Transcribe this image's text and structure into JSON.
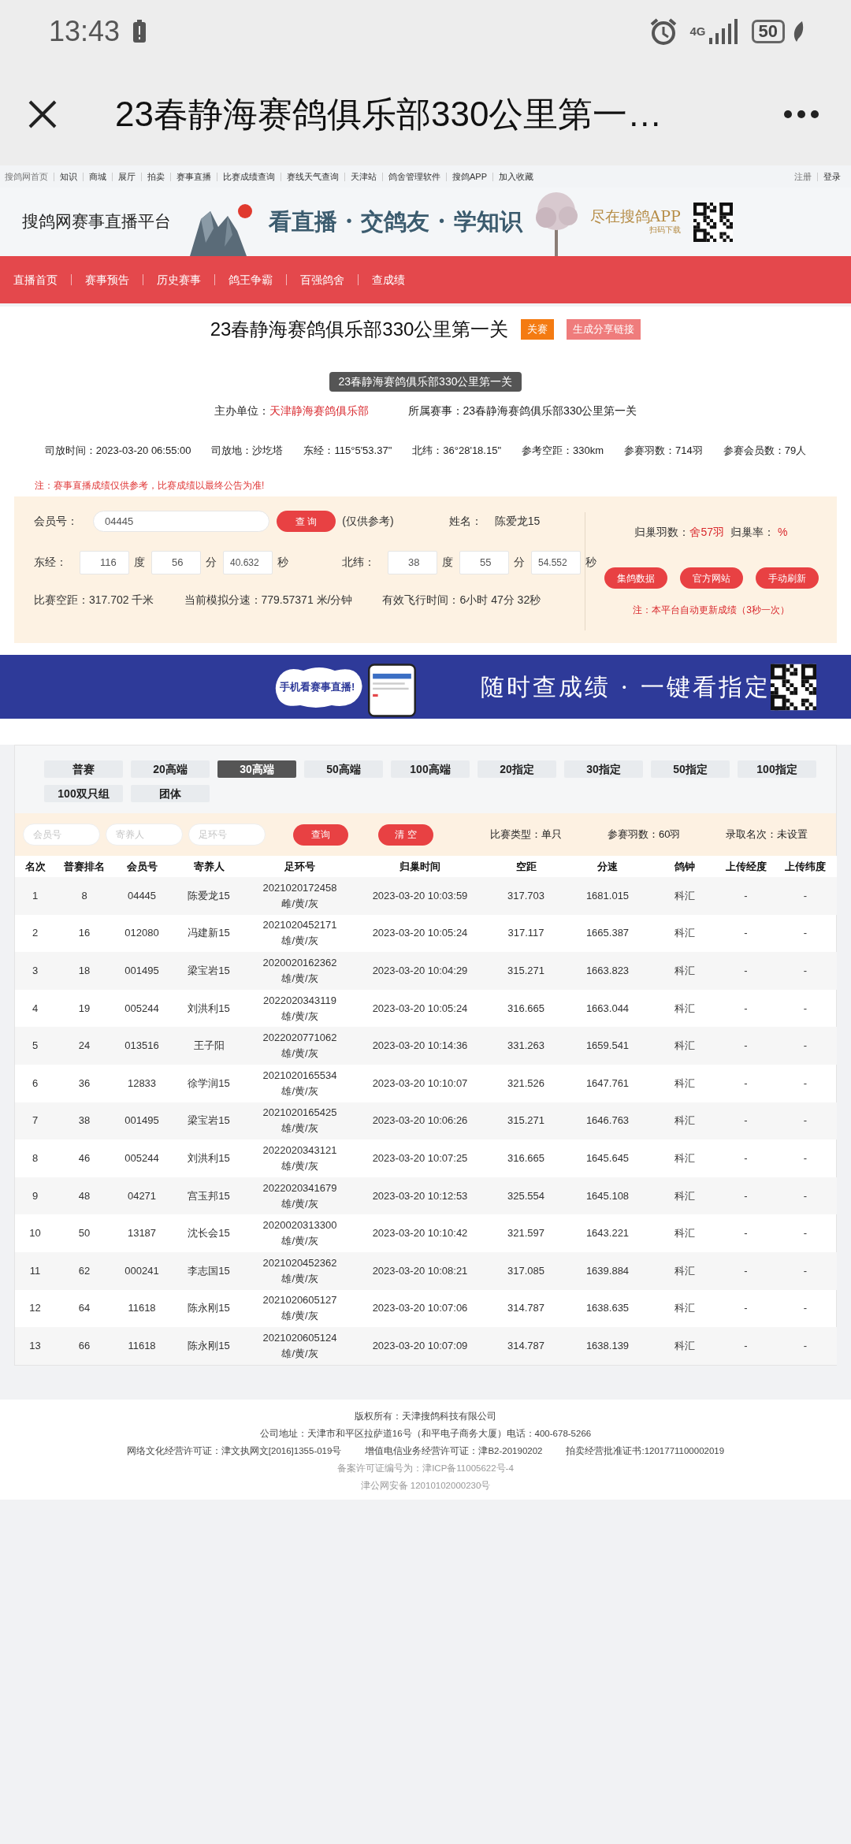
{
  "status_bar": {
    "time": "13:43",
    "network": "4G",
    "battery": "50"
  },
  "title_bar": {
    "title": "23春静海赛鸽俱乐部330公里第一…"
  },
  "top_links": {
    "left": [
      "搜鸽网首页",
      "知识",
      "商城",
      "展厅",
      "拍卖",
      "赛事直播",
      "比赛成绩查询",
      "赛线天气查询",
      "天津站",
      "鸽舍管理软件",
      "搜鸽APP",
      "加入收藏"
    ],
    "right": [
      "注册",
      "登录"
    ]
  },
  "banner": {
    "platform": "搜鸽网赛事直播平台",
    "slogan": "看直播 · 交鸽友 · 学知识",
    "app": "尽在搜鸽APP",
    "scan": "扫码下载"
  },
  "nav": [
    "直播首页",
    "赛事预告",
    "历史赛事",
    "鸽王争霸",
    "百强鸽舍",
    "查成绩"
  ],
  "race": {
    "title": "23春静海赛鸽俱乐部330公里第一关",
    "tag": "关赛",
    "share": "生成分享链接",
    "pill": "23春静海赛鸽俱乐部330公里第一关",
    "organizer_label": "主办单位：",
    "organizer": "天津静海赛鸽俱乐部",
    "event_label": "所属赛事：",
    "event": "23春静海赛鸽俱乐部330公里第一关",
    "facts": [
      {
        "label": "司放时间：",
        "value": "2023-03-20 06:55:00"
      },
      {
        "label": "司放地：",
        "value": "沙圪塔"
      },
      {
        "label": "东经：",
        "value": "115°5'53.37\""
      },
      {
        "label": "北纬：",
        "value": "36°28'18.15\""
      },
      {
        "label": "参考空距：",
        "value": "330km"
      },
      {
        "label": "参赛羽数：",
        "value": "714羽"
      },
      {
        "label": "参赛会员数：",
        "value": "79人"
      }
    ]
  },
  "notice": "注：赛事直播成绩仅供参考，比赛成绩以最终公告为准!",
  "query": {
    "member_label": "会员号：",
    "member": "04445",
    "search": "查 询",
    "hint": "(仅供参考)",
    "name_label": "姓名：",
    "name": "陈爱龙15",
    "lon_label": "东经：",
    "lon": [
      "116",
      "56",
      "40.632"
    ],
    "lon_units": [
      "度",
      "分",
      "秒"
    ],
    "lat_label": "北纬：",
    "lat": [
      "38",
      "55",
      "54.552"
    ],
    "lat_units": [
      "度",
      "分",
      "秒"
    ],
    "stats": [
      {
        "label": "比赛空距：",
        "value": "317.702 千米"
      },
      {
        "label": "当前模拟分速：",
        "value": "779.57371 米/分钟"
      },
      {
        "label": "有效飞行时间：",
        "value": "6小时 47分 32秒"
      }
    ],
    "return_label": "归巢羽数：",
    "return_value": "舍57羽",
    "rate_label": "归巢率：",
    "rate_value": "%",
    "buttons": [
      "集鸽数据",
      "官方网站",
      "手动刷新"
    ],
    "auto_note": "注：本平台自动更新成绩（3秒一次）"
  },
  "ad": {
    "bubble": "手机看赛事直播!",
    "slogan": "随时查成绩 · 一键看指定"
  },
  "results": {
    "tabs": [
      {
        "label": "普赛",
        "selected": false
      },
      {
        "label": "20高端",
        "selected": false
      },
      {
        "label": "30高端",
        "selected": true
      },
      {
        "label": "50高端",
        "selected": false
      },
      {
        "label": "100高端",
        "selected": false
      },
      {
        "label": "20指定",
        "selected": false
      },
      {
        "label": "30指定",
        "selected": false
      },
      {
        "label": "50指定",
        "selected": false
      },
      {
        "label": "100指定",
        "selected": false
      },
      {
        "label": "100双只组",
        "selected": false
      },
      {
        "label": "团体",
        "selected": false
      }
    ],
    "filters": [
      {
        "placeholder": "会员号"
      },
      {
        "placeholder": "寄养人"
      },
      {
        "placeholder": "足环号"
      }
    ],
    "buttons": [
      "查询",
      "清 空"
    ],
    "facts": [
      {
        "label": "比赛类型：",
        "value": "单只"
      },
      {
        "label": "参赛羽数：",
        "value": "60羽"
      },
      {
        "label": "录取名次：",
        "value": "未设置"
      }
    ],
    "columns": [
      "名次",
      "普赛排名",
      "会员号",
      "寄养人",
      "足环号",
      "归巢时间",
      "空距",
      "分速",
      "鸽钟",
      "上传经度",
      "上传纬度"
    ],
    "rows": [
      {
        "rank": "1",
        "overall": "8",
        "member": "04445",
        "owner": "陈爱龙15",
        "ring": "2021020172458",
        "ring_note": "雌/黄/灰",
        "time": "2023-03-20 10:03:59",
        "distance": "317.703",
        "speed": "1681.015",
        "clock": "科汇",
        "lon": "-",
        "lat": "-"
      },
      {
        "rank": "2",
        "overall": "16",
        "member": "012080",
        "owner": "冯建新15",
        "ring": "2021020452171",
        "ring_note": "雄/黄/灰",
        "time": "2023-03-20 10:05:24",
        "distance": "317.117",
        "speed": "1665.387",
        "clock": "科汇",
        "lon": "-",
        "lat": "-"
      },
      {
        "rank": "3",
        "overall": "18",
        "member": "001495",
        "owner": "梁宝岩15",
        "ring": "2020020162362",
        "ring_note": "雄/黄/灰",
        "time": "2023-03-20 10:04:29",
        "distance": "315.271",
        "speed": "1663.823",
        "clock": "科汇",
        "lon": "-",
        "lat": "-"
      },
      {
        "rank": "4",
        "overall": "19",
        "member": "005244",
        "owner": "刘洪利15",
        "ring": "2022020343119",
        "ring_note": "雄/黄/灰",
        "time": "2023-03-20 10:05:24",
        "distance": "316.665",
        "speed": "1663.044",
        "clock": "科汇",
        "lon": "-",
        "lat": "-"
      },
      {
        "rank": "5",
        "overall": "24",
        "member": "013516",
        "owner": "王子阳",
        "ring": "2022020771062",
        "ring_note": "雄/黄/灰",
        "time": "2023-03-20 10:14:36",
        "distance": "331.263",
        "speed": "1659.541",
        "clock": "科汇",
        "lon": "-",
        "lat": "-"
      },
      {
        "rank": "6",
        "overall": "36",
        "member": "12833",
        "owner": "徐学润15",
        "ring": "2021020165534",
        "ring_note": "雄/黄/灰",
        "time": "2023-03-20 10:10:07",
        "distance": "321.526",
        "speed": "1647.761",
        "clock": "科汇",
        "lon": "-",
        "lat": "-"
      },
      {
        "rank": "7",
        "overall": "38",
        "member": "001495",
        "owner": "梁宝岩15",
        "ring": "2021020165425",
        "ring_note": "雄/黄/灰",
        "time": "2023-03-20 10:06:26",
        "distance": "315.271",
        "speed": "1646.763",
        "clock": "科汇",
        "lon": "-",
        "lat": "-"
      },
      {
        "rank": "8",
        "overall": "46",
        "member": "005244",
        "owner": "刘洪利15",
        "ring": "2022020343121",
        "ring_note": "雄/黄/灰",
        "time": "2023-03-20 10:07:25",
        "distance": "316.665",
        "speed": "1645.645",
        "clock": "科汇",
        "lon": "-",
        "lat": "-"
      },
      {
        "rank": "9",
        "overall": "48",
        "member": "04271",
        "owner": "宫玉邦15",
        "ring": "2022020341679",
        "ring_note": "雄/黄/灰",
        "time": "2023-03-20 10:12:53",
        "distance": "325.554",
        "speed": "1645.108",
        "clock": "科汇",
        "lon": "-",
        "lat": "-"
      },
      {
        "rank": "10",
        "overall": "50",
        "member": "13187",
        "owner": "沈长会15",
        "ring": "2020020313300",
        "ring_note": "雄/黄/灰",
        "time": "2023-03-20 10:10:42",
        "distance": "321.597",
        "speed": "1643.221",
        "clock": "科汇",
        "lon": "-",
        "lat": "-"
      },
      {
        "rank": "11",
        "overall": "62",
        "member": "000241",
        "owner": "李志国15",
        "ring": "2021020452362",
        "ring_note": "雄/黄/灰",
        "time": "2023-03-20 10:08:21",
        "distance": "317.085",
        "speed": "1639.884",
        "clock": "科汇",
        "lon": "-",
        "lat": "-"
      },
      {
        "rank": "12",
        "overall": "64",
        "member": "11618",
        "owner": "陈永刚15",
        "ring": "2021020605127",
        "ring_note": "雄/黄/灰",
        "time": "2023-03-20 10:07:06",
        "distance": "314.787",
        "speed": "1638.635",
        "clock": "科汇",
        "lon": "-",
        "lat": "-"
      },
      {
        "rank": "13",
        "overall": "66",
        "member": "11618",
        "owner": "陈永刚15",
        "ring": "2021020605124",
        "ring_note": "雄/黄/灰",
        "time": "2023-03-20 10:07:09",
        "distance": "314.787",
        "speed": "1638.139",
        "clock": "科汇",
        "lon": "-",
        "lat": "-"
      }
    ]
  },
  "footer": [
    {
      "parts": [
        "版权所有：天津搜鸽科技有限公司"
      ],
      "muted": false
    },
    {
      "parts": [
        "公司地址：天津市和平区拉萨道16号（和平电子商务大厦）电话：400-678-5266"
      ],
      "muted": false
    },
    {
      "parts": [
        "网络文化经营许可证：津文执网文[2016]1355-019号",
        "增值电信业务经营许可证：津B2-20190202",
        "拍卖经营批准证书:1201771100002019"
      ],
      "muted": false
    },
    {
      "parts": [
        "备案许可证编号为：津ICP备11005622号-4"
      ],
      "muted": true
    },
    {
      "parts": [
        "津公网安备 12010102000230号"
      ],
      "muted": true
    }
  ]
}
